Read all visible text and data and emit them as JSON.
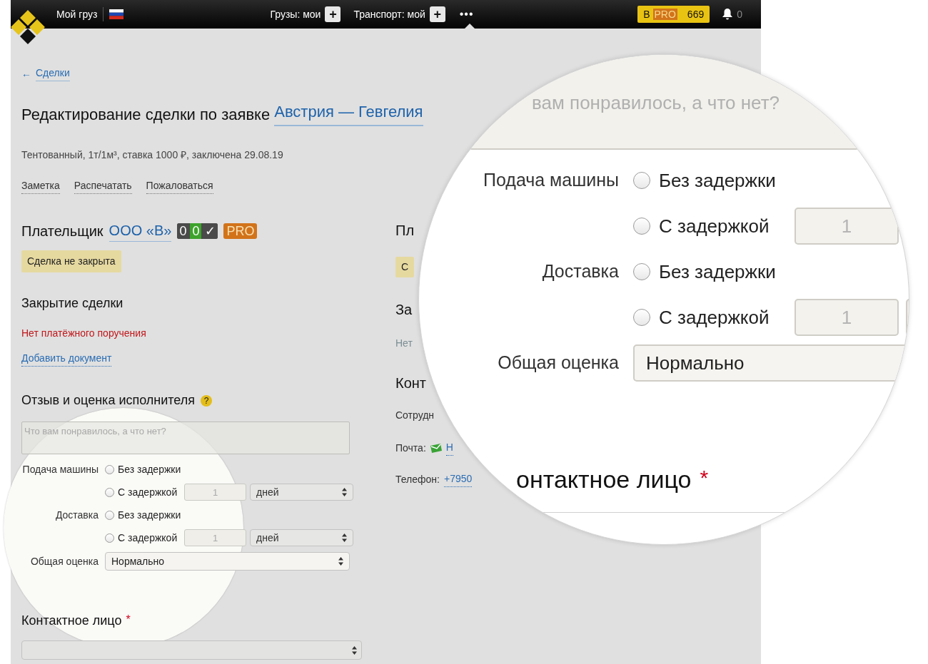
{
  "topbar": {
    "brand": "Мой груз",
    "nav": [
      {
        "label": "Грузы: мои",
        "add": "+"
      },
      {
        "label": "Транспорт: мой",
        "add": "+"
      }
    ],
    "more": "•••",
    "account": {
      "letter": "В",
      "pro": "PRO",
      "count": "669"
    },
    "notifications": "0"
  },
  "back_link": {
    "arrow": "←",
    "label": "Сделки"
  },
  "title": {
    "text": "Редактирование сделки по заявке",
    "link": "Австрия — Гевгелия"
  },
  "meta": "Тентованный, 1т/1м³, ставка 1000 ₽, заключена 29.08.19",
  "actions": [
    "Заметка",
    "Распечатать",
    "Пожаловаться"
  ],
  "payer": {
    "label": "Плательщик",
    "company": "ООО «В»",
    "scores": [
      {
        "text": "0",
        "color": "#4a4a4a"
      },
      {
        "text": "0",
        "color": "#3da32b"
      },
      {
        "text": "✓",
        "color": "#4a4a4a"
      }
    ],
    "pro": "PRO",
    "status": "Сделка не закрыта"
  },
  "closing": {
    "title": "Закрытие сделки",
    "warning": "Нет платёжного поручения",
    "add_link": "Добавить документ"
  },
  "review": {
    "title": "Отзыв и оценка исполнителя",
    "help": "?",
    "comment": {
      "placeholder": "Что вам понравилось, а что нет?"
    },
    "rows": [
      {
        "label": "Подача машины",
        "options": [
          {
            "label": "Без задержки",
            "selected": false
          },
          {
            "label": "С задержкой",
            "selected": false,
            "amount": "1",
            "unit": "дней"
          }
        ]
      },
      {
        "label": "Доставка",
        "options": [
          {
            "label": "Без задержки",
            "selected": false
          },
          {
            "label": "С задержкой",
            "selected": false,
            "amount": "1",
            "unit": "дней"
          }
        ]
      }
    ],
    "overall": {
      "label": "Общая оценка",
      "value": "Нормально"
    }
  },
  "contact": {
    "title": "Контактное лицо",
    "required": "*"
  },
  "right_column": [
    {
      "kind": "heading",
      "text": "Пл"
    },
    {
      "kind": "badge",
      "text": "С"
    },
    {
      "kind": "heading",
      "text": "За"
    },
    {
      "kind": "muted",
      "text": "Нет"
    },
    {
      "kind": "heading",
      "text": "Конт"
    },
    {
      "kind": "label",
      "text": "Сотрудн"
    },
    {
      "kind": "email",
      "text": "Почта:",
      "value": "Н"
    },
    {
      "kind": "phone",
      "text": "Телефон:",
      "value": "+7950"
    }
  ],
  "magnifier": {
    "comment_placeholder": "вам понравилось, а что нет?",
    "rows": [
      {
        "label": "Подача машины",
        "options": [
          {
            "label": "Без задержки",
            "selected": false
          },
          {
            "label": "С задержкой",
            "selected": false,
            "amount": "1"
          }
        ]
      },
      {
        "label": "Доставка",
        "options": [
          {
            "label": "Без задержки",
            "selected": false
          },
          {
            "label": "С задержкой",
            "selected": false,
            "amount": "1"
          }
        ]
      }
    ],
    "overall": {
      "label": "Общая оценка",
      "value": "Нормально"
    },
    "contact_title": "онтактное лицо",
    "required": "*"
  }
}
